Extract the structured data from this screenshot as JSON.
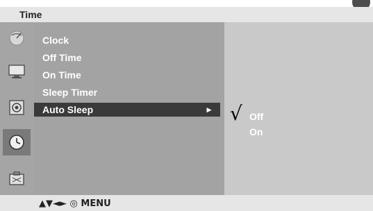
{
  "header": {
    "title": "Time"
  },
  "menu": {
    "items": [
      {
        "label": "Clock"
      },
      {
        "label": "Off Time"
      },
      {
        "label": "On Time"
      },
      {
        "label": "Sleep Timer"
      },
      {
        "label": "Auto Sleep",
        "arrow": "►"
      }
    ],
    "selected_index": 4
  },
  "options": [
    {
      "label": "Off",
      "checked": true,
      "check_glyph": "√"
    },
    {
      "label": "On",
      "checked": false
    }
  ],
  "sidebar": {
    "icons": [
      {
        "name": "satellite-dish-icon"
      },
      {
        "name": "picture-monitor-icon"
      },
      {
        "name": "speaker-audio-icon"
      },
      {
        "name": "clock-time-icon",
        "active": true
      },
      {
        "name": "toolbox-option-icon"
      }
    ]
  },
  "footer": {
    "nav_hint": "▲▼◄► ◎ MENU"
  },
  "colors": {
    "title_bar": "#e6e6e6",
    "rail": "#a5a5a5",
    "list_panel": "#a3a3a3",
    "selected_row": "#3a3a3a",
    "options_panel": "#c9c9c9"
  }
}
